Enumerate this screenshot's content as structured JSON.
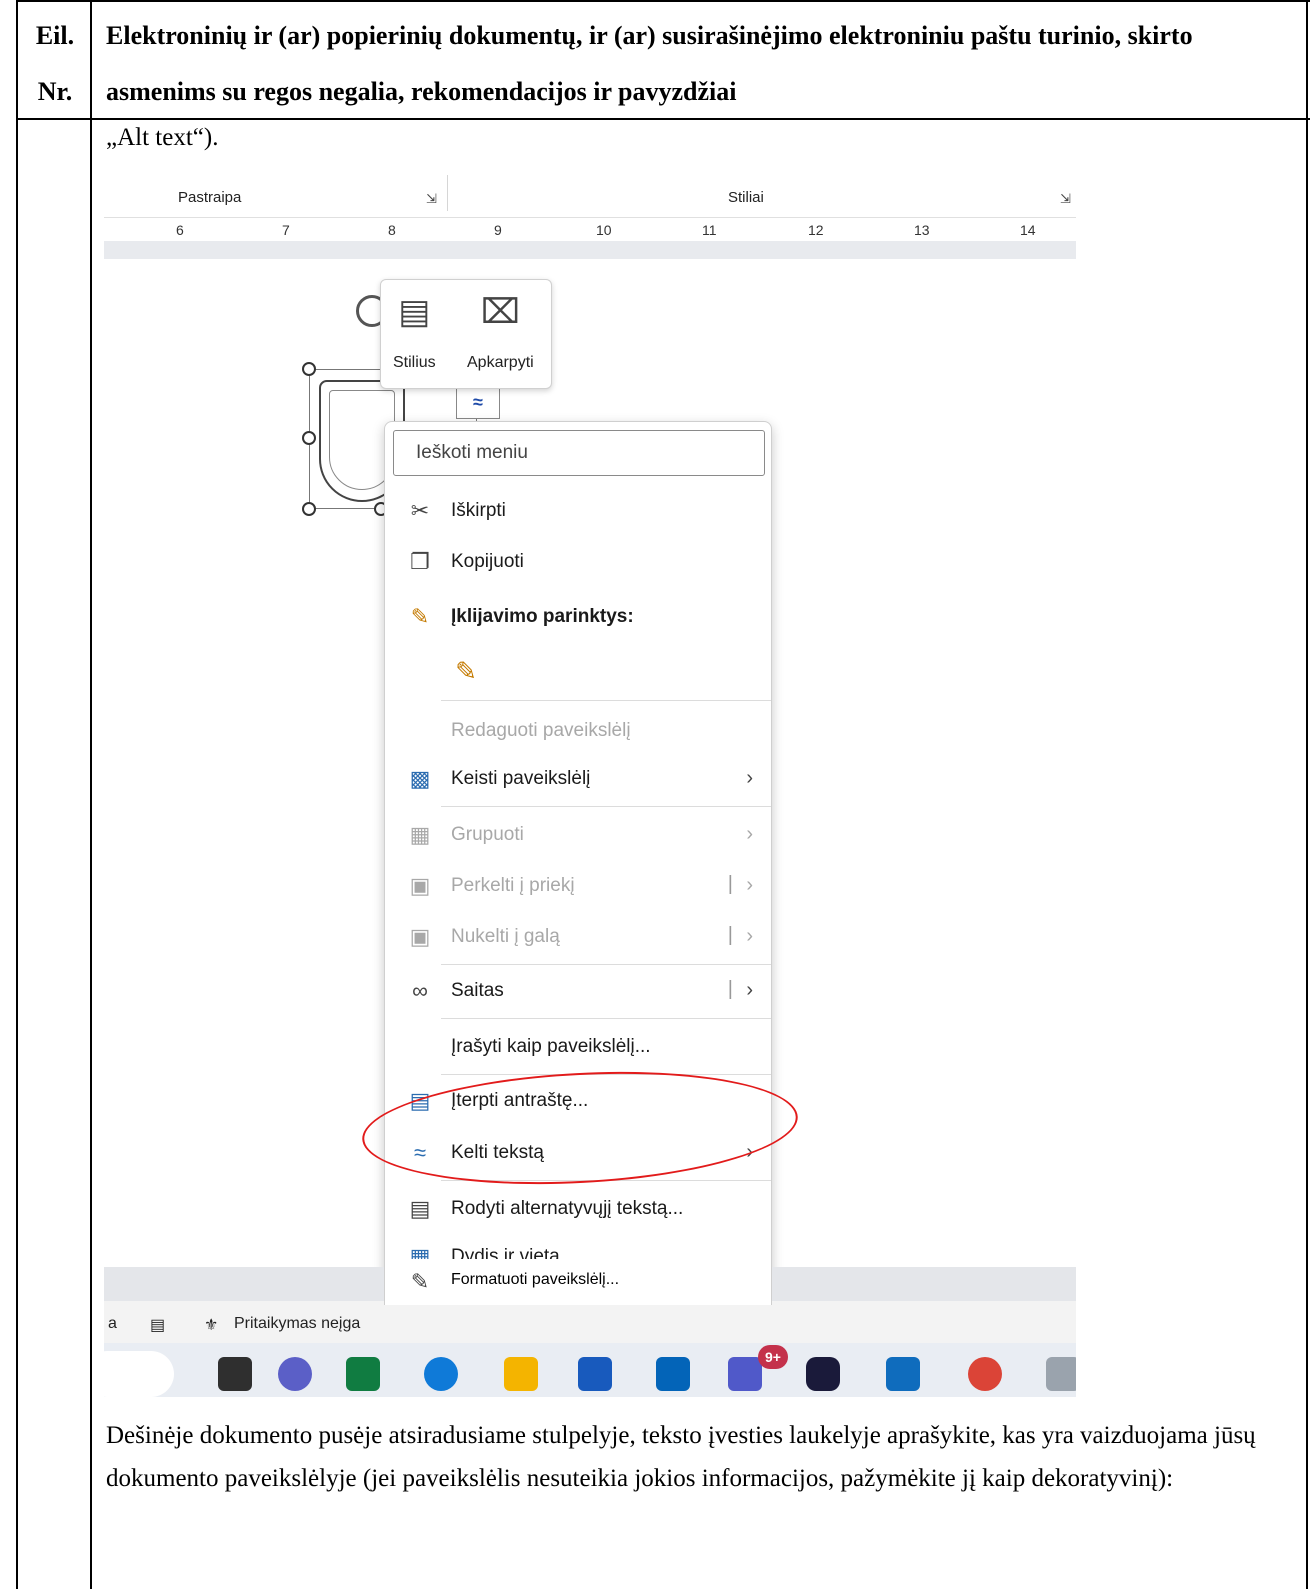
{
  "header": {
    "col1": "Eil. Nr.",
    "col2": "Elektroninių ir (ar) popierinių dokumentų, ir (ar) susirašinėjimo elektroniniu paštu turinio, skirto asmenims su regos negalia, rekomendacijos ir pavyzdžiai"
  },
  "intro_text": "„Alt text“).",
  "screenshot": {
    "ribbon": {
      "group1": "Pastraipa",
      "group2": "Stiliai"
    },
    "ruler_ticks": [
      "6",
      "7",
      "8",
      "9",
      "10",
      "11",
      "12",
      "13",
      "14"
    ],
    "mini_toolbar": {
      "style_label": "Stilius",
      "crop_label": "Apkarpyti"
    },
    "menu": {
      "search_placeholder": "Ieškoti meniu",
      "items": [
        {
          "label": "Iškirpti",
          "icon": "scissors-icon"
        },
        {
          "label": "Kopijuoti",
          "icon": "copy-icon"
        },
        {
          "label": "Įklijavimo parinktys:",
          "icon": "paste-icon"
        },
        {
          "label": "Redaguoti paveikslėlį",
          "icon": ""
        },
        {
          "label": "Keisti paveikslėlį",
          "icon": "change-picture-icon"
        },
        {
          "label": "Grupuoti",
          "icon": "group-icon"
        },
        {
          "label": "Perkelti į priekį",
          "icon": "bring-forward-icon"
        },
        {
          "label": "Nukelti į galą",
          "icon": "send-backward-icon"
        },
        {
          "label": "Saitas",
          "icon": "link-icon"
        },
        {
          "label": "Įrašyti kaip paveikslėlį...",
          "icon": ""
        },
        {
          "label": "Įterpti antraštę...",
          "icon": "caption-icon"
        },
        {
          "label": "Kelti tekstą",
          "icon": "wrap-text-icon"
        },
        {
          "label": "Rodyti alternatyvųjį tekstą...",
          "icon": "alt-text-icon"
        },
        {
          "label": "Dydis ir vieta...",
          "icon": "size-position-icon"
        },
        {
          "label": "Formatuoti paveikslėlį...",
          "icon": "format-picture-icon"
        }
      ]
    },
    "statusbar": {
      "left_char": "a",
      "accessibility": "Pritaikymas neįga"
    },
    "taskbar_badge": "9+"
  },
  "body_text": "Dešinėje dokumento pusėje atsiradusiame stulpelyje, teksto įvesties laukelyje aprašykite, kas yra vaizduojama jūsų dokumento paveikslėlyje (jei paveikslėlis nesuteikia jokios informacijos, pažymėkite jį kaip dekoratyvinį):",
  "colors": {
    "highlight_ring": "#e21b1b",
    "teams_badge": "#c4314b"
  }
}
